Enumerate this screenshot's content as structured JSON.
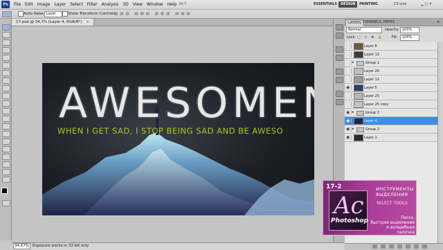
{
  "menubar": {
    "logo": "Ps",
    "items": [
      "File",
      "Edit",
      "Image",
      "Layer",
      "Select",
      "Filter",
      "Analysis",
      "3D",
      "View",
      "Window",
      "Help"
    ],
    "zoom": "34,7",
    "workspaces": [
      "ESSENTIALS",
      "DESIGN",
      "PAINTING"
    ],
    "active_workspace": "DESIGN",
    "cs_live": "CS Live"
  },
  "options_bar": {
    "auto_select_label": "Auto-Select:",
    "auto_select_value": "Layer",
    "show_transform_label": "Show Transform Controls"
  },
  "document": {
    "tab_title": "17.psd @ 34,7% (Layer 4, RGB/8*)",
    "close_symbol": "×",
    "big_word": "AWESOMENE",
    "tagline": "WHEN I GET SAD, I STOP BEING SAD AND BE AWESO"
  },
  "status_bar": {
    "zoom": "34,67%",
    "message": "Exposure works in 32-bit only"
  },
  "layers_panel": {
    "tabs": [
      "LAYERS",
      "CHANNELS",
      "PATHS"
    ],
    "active_tab": "LAYERS",
    "blend_mode": "Normal",
    "opacity_label": "Opacity:",
    "opacity_value": "100%",
    "lock_label": "Lock:",
    "fill_label": "Fill:",
    "fill_value": "100%",
    "layers": [
      {
        "name": "Layer 8",
        "kind": "layer",
        "visible": false,
        "thumb": "#6a5a3c"
      },
      {
        "name": "Layer 13",
        "kind": "layer",
        "visible": false,
        "thumb": "#3c3c3c"
      },
      {
        "name": "Group 1",
        "kind": "group",
        "visible": false
      },
      {
        "name": "Layer 26",
        "kind": "layer",
        "visible": false,
        "thumb": "#bfbfbf"
      },
      {
        "name": "Layer 12",
        "kind": "layer",
        "visible": false,
        "thumb": "#9a9a9a"
      },
      {
        "name": "Layer 5",
        "kind": "layer",
        "visible": true,
        "thumb": "#2f3f66"
      },
      {
        "name": "Layer 25",
        "kind": "layer",
        "visible": false,
        "thumb": "#b6b6b6"
      },
      {
        "name": "Layer 25 copy",
        "kind": "layer",
        "visible": false,
        "thumb": "#c2c2c2"
      },
      {
        "name": "Group 3",
        "kind": "group",
        "visible": true
      },
      {
        "name": "Layer 4",
        "kind": "layer",
        "visible": true,
        "selected": true,
        "thumb": "#1f2a3f"
      },
      {
        "name": "Group 2",
        "kind": "group",
        "visible": true
      },
      {
        "name": "Layer 1",
        "kind": "layer",
        "visible": true,
        "thumb": "#2a2d35"
      }
    ]
  },
  "course_badge": {
    "lesson": "17-2",
    "logo_letters": "Ac",
    "logo_name": "Photoshop",
    "ru_title_line1": "ИНСТРУМЕНТЫ",
    "ru_title_line2": "ВЫДЕЛЕНИЯ",
    "en_title": "SELECT TOOLS",
    "desc_line1": "Лассо,",
    "desc_line2": "быстрое выделение",
    "desc_line3": "и волшебная палочка"
  },
  "colors": {
    "selected_layer": "#3b8fdf",
    "tagline": "#a6c81f",
    "badge": "#a83c96"
  }
}
